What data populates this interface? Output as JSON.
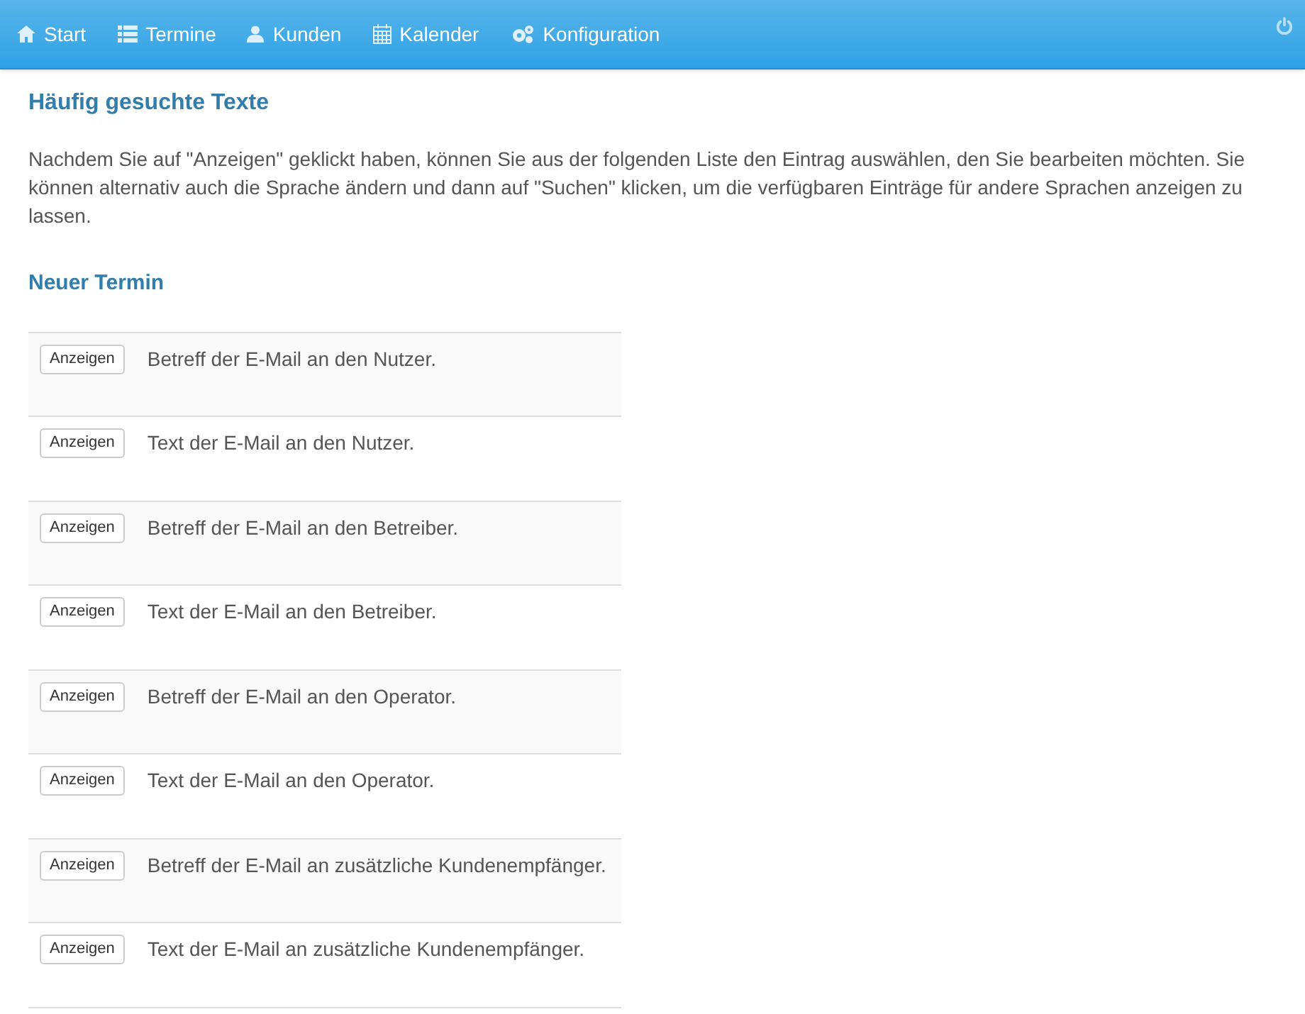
{
  "navbar": {
    "items": [
      {
        "label": "Start"
      },
      {
        "label": "Termine"
      },
      {
        "label": "Kunden"
      },
      {
        "label": "Kalender"
      },
      {
        "label": "Konfiguration"
      }
    ]
  },
  "heading": "Häufig gesuchte Texte",
  "intro": "Nachdem Sie auf \"Anzeigen\" geklickt haben, können Sie aus der folgenden Liste den Eintrag auswählen, den Sie bearbeiten möchten. Sie können alternativ auch die Sprache ändern und dann auf \"Suchen\" klicken, um die verfügbaren Einträge für andere Sprachen anzeigen zu lassen.",
  "section": "Neuer Termin",
  "rows": [
    {
      "button": "Anzeigen",
      "text": "Betreff der E-Mail an den Nutzer."
    },
    {
      "button": "Anzeigen",
      "text": "Text der E-Mail an den Nutzer."
    },
    {
      "button": "Anzeigen",
      "text": "Betreff der E-Mail an den Betreiber."
    },
    {
      "button": "Anzeigen",
      "text": "Text der E-Mail an den Betreiber."
    },
    {
      "button": "Anzeigen",
      "text": "Betreff der E-Mail an den Operator."
    },
    {
      "button": "Anzeigen",
      "text": "Text der E-Mail an den Operator."
    },
    {
      "button": "Anzeigen",
      "text": "Betreff der E-Mail an zusätzliche Kundenempfänger."
    },
    {
      "button": "Anzeigen",
      "text": "Text der E-Mail an zusätzliche Kundenempfänger."
    }
  ]
}
